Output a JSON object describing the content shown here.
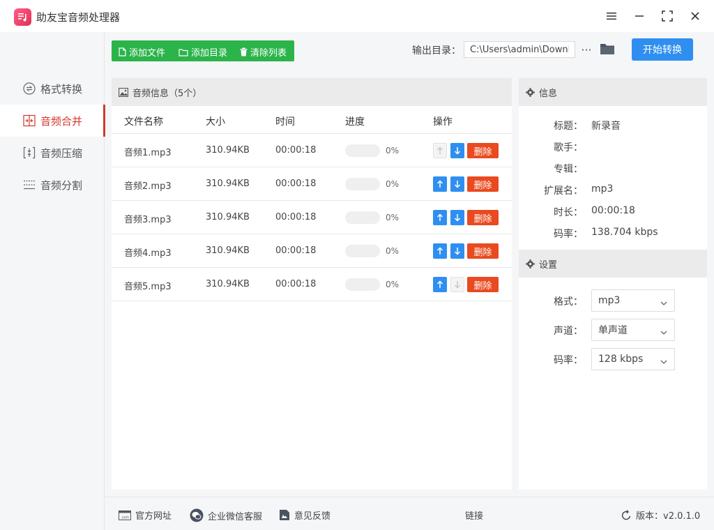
{
  "app": {
    "title": "助友宝音频处理器"
  },
  "sidebar": {
    "items": [
      {
        "label": "格式转换",
        "icon": "convert-icon",
        "active": false
      },
      {
        "label": "音频合并",
        "icon": "merge-icon",
        "active": true
      },
      {
        "label": "音频压缩",
        "icon": "compress-icon",
        "active": false
      },
      {
        "label": "音频分割",
        "icon": "split-icon",
        "active": false
      }
    ]
  },
  "toolbar": {
    "add_file": "添加文件",
    "add_folder": "添加目录",
    "clear_list": "清除列表",
    "output_label": "输出目录：",
    "output_path": "C:\\Users\\admin\\Downlo",
    "more": "···",
    "start": "开始转换"
  },
  "file_list": {
    "header": "音频信息（5个）",
    "columns": {
      "name": "文件名称",
      "size": "大小",
      "time": "时间",
      "progress": "进度",
      "action": "操作"
    },
    "delete_label": "删除",
    "rows": [
      {
        "name": "音频1.mp3",
        "size": "310.94KB",
        "time": "00:00:18",
        "progress": "0%",
        "up_enabled": false,
        "down_enabled": true
      },
      {
        "name": "音频2.mp3",
        "size": "310.94KB",
        "time": "00:00:18",
        "progress": "0%",
        "up_enabled": true,
        "down_enabled": true
      },
      {
        "name": "音频3.mp3",
        "size": "310.94KB",
        "time": "00:00:18",
        "progress": "0%",
        "up_enabled": true,
        "down_enabled": true
      },
      {
        "name": "音频4.mp3",
        "size": "310.94KB",
        "time": "00:00:18",
        "progress": "0%",
        "up_enabled": true,
        "down_enabled": true
      },
      {
        "name": "音频5.mp3",
        "size": "310.94KB",
        "time": "00:00:18",
        "progress": "0%",
        "up_enabled": true,
        "down_enabled": false
      }
    ]
  },
  "info": {
    "header": "信息",
    "fields": [
      {
        "label": "标题：",
        "value": "新录音"
      },
      {
        "label": "歌手：",
        "value": ""
      },
      {
        "label": "专辑：",
        "value": ""
      },
      {
        "label": "扩展名：",
        "value": "mp3"
      },
      {
        "label": "时长：",
        "value": "00:00:18"
      },
      {
        "label": "码率：",
        "value": "138.704 kbps"
      }
    ]
  },
  "settings": {
    "header": "设置",
    "fields": [
      {
        "label": "格式：",
        "value": "mp3"
      },
      {
        "label": "声道：",
        "value": "单声道"
      },
      {
        "label": "码率：",
        "value": "128 kbps"
      }
    ]
  },
  "footer": {
    "website": "官方网址",
    "wechat": "企业微信客服",
    "feedback": "意见反馈",
    "link": "链接",
    "version": "版本：v2.0.1.0"
  },
  "colors": {
    "accent_green": "#2bb44a",
    "accent_blue": "#2f8ff0",
    "danger": "#e94a1f",
    "nav_active": "#d23a2c"
  }
}
